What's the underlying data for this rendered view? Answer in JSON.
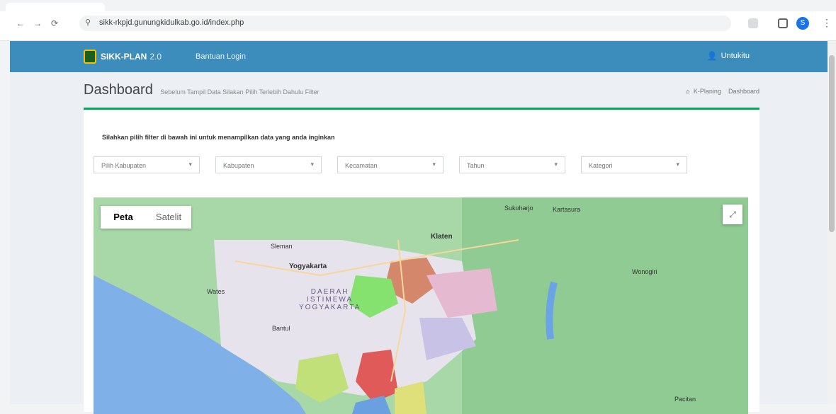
{
  "browser": {
    "url": "sikk-rkpjd.gunungkidulkab.go.id/index.php",
    "back_glyph": "←",
    "forward_glyph": "→",
    "reload_glyph": "⟳",
    "secure_glyph": "⚲",
    "profile_initial": "S",
    "menu_glyph": "⋮"
  },
  "app": {
    "brand_name": "SIKK-PLAN",
    "brand_version": "2.0",
    "nav_item": "Bantuan Login",
    "user_label": "Untukitu"
  },
  "page": {
    "title": "Dashboard",
    "subtitle": "Sebelum Tampil Data Silakan Pilih Terlebih Dahulu Filter",
    "breadcrumb": [
      "K-Planing",
      "Dashboard"
    ]
  },
  "filters": {
    "instruction": "Silahkan pilih filter di bawah ini untuk menampilkan data yang anda inginkan",
    "selects": [
      {
        "label": "Pilih Kabupaten"
      },
      {
        "label": "Kabupaten"
      },
      {
        "label": "Kecamatan"
      },
      {
        "label": "Tahun"
      },
      {
        "label": "Kategori"
      }
    ]
  },
  "map": {
    "type_options": [
      "Peta",
      "Satelit"
    ],
    "fullscreen_glyph": "⤢",
    "region_label": [
      "DAERAH",
      "ISTIMEWA",
      "YOGYAKARTA"
    ],
    "place_labels": [
      {
        "text": "Klaten",
        "cls": "city"
      },
      {
        "text": "Yogyakarta",
        "cls": "city"
      },
      {
        "text": "Sukoharjo",
        "cls": ""
      },
      {
        "text": "Wonogiri",
        "cls": ""
      },
      {
        "text": "Kartasura",
        "cls": ""
      },
      {
        "text": "Sleman",
        "cls": ""
      },
      {
        "text": "Bantul",
        "cls": ""
      },
      {
        "text": "Wates",
        "cls": ""
      },
      {
        "text": "Pacitan",
        "cls": ""
      }
    ]
  },
  "colors": {
    "appbar": "#3c8dbc",
    "box_top": "#00a65a",
    "sea": "#7fb0e8",
    "land": "#9fd3a3"
  }
}
